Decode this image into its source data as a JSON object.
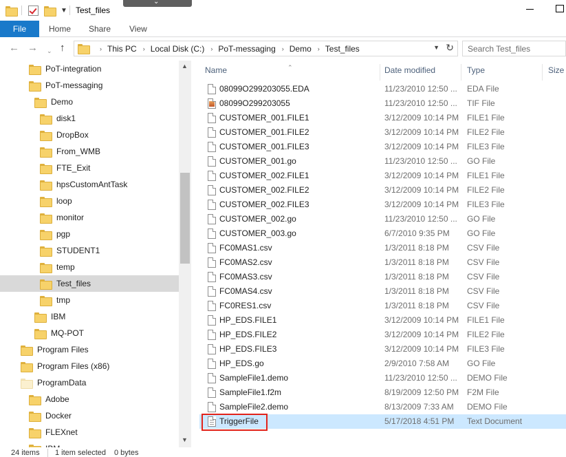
{
  "window": {
    "title": "Test_files"
  },
  "ribbon": {
    "file_tab": "File",
    "tabs": [
      "Home",
      "Share",
      "View"
    ]
  },
  "address": {
    "crumbs": [
      "This PC",
      "Local Disk (C:)",
      "PoT-messaging",
      "Demo",
      "Test_files"
    ],
    "search_placeholder": "Search Test_files"
  },
  "navigation": {
    "items": [
      {
        "label": "PoT-integration",
        "level": 1,
        "selected": false
      },
      {
        "label": "PoT-messaging",
        "level": 1,
        "selected": false
      },
      {
        "label": "Demo",
        "level": 2,
        "selected": false
      },
      {
        "label": "disk1",
        "level": 3,
        "selected": false
      },
      {
        "label": "DropBox",
        "level": 3,
        "selected": false
      },
      {
        "label": "From_WMB",
        "level": 3,
        "selected": false
      },
      {
        "label": "FTE_Exit",
        "level": 3,
        "selected": false
      },
      {
        "label": "hpsCustomAntTask",
        "level": 3,
        "selected": false
      },
      {
        "label": "loop",
        "level": 3,
        "selected": false
      },
      {
        "label": "monitor",
        "level": 3,
        "selected": false
      },
      {
        "label": "pgp",
        "level": 3,
        "selected": false
      },
      {
        "label": "STUDENT1",
        "level": 3,
        "selected": false
      },
      {
        "label": "temp",
        "level": 3,
        "selected": false
      },
      {
        "label": "Test_files",
        "level": 3,
        "selected": true
      },
      {
        "label": "tmp",
        "level": 3,
        "selected": false
      },
      {
        "label": "IBM",
        "level": 2,
        "selected": false
      },
      {
        "label": "MQ-POT",
        "level": 2,
        "selected": false
      },
      {
        "label": "Program Files",
        "level": 0,
        "selected": false
      },
      {
        "label": "Program Files (x86)",
        "level": 0,
        "selected": false
      },
      {
        "label": "ProgramData",
        "level": 0,
        "selected": false,
        "pale": true
      },
      {
        "label": "Adobe",
        "level": 1,
        "selected": false
      },
      {
        "label": "Docker",
        "level": 1,
        "selected": false
      },
      {
        "label": "FLEXnet",
        "level": 1,
        "selected": false
      },
      {
        "label": "IBM",
        "level": 1,
        "selected": false
      }
    ]
  },
  "columns": {
    "name": "Name",
    "date": "Date modified",
    "type": "Type",
    "size": "Size"
  },
  "files": [
    {
      "name": "08099O299203055.EDA",
      "date": "11/23/2010 12:50 ...",
      "type": "EDA File",
      "icon": "file-icon"
    },
    {
      "name": "08099O299203055",
      "date": "11/23/2010 12:50 ...",
      "type": "TIF File",
      "icon": "image-file-icon"
    },
    {
      "name": "CUSTOMER_001.FILE1",
      "date": "3/12/2009 10:14 PM",
      "type": "FILE1 File",
      "icon": "file-icon"
    },
    {
      "name": "CUSTOMER_001.FILE2",
      "date": "3/12/2009 10:14 PM",
      "type": "FILE2 File",
      "icon": "file-icon"
    },
    {
      "name": "CUSTOMER_001.FILE3",
      "date": "3/12/2009 10:14 PM",
      "type": "FILE3 File",
      "icon": "file-icon"
    },
    {
      "name": "CUSTOMER_001.go",
      "date": "11/23/2010 12:50 ...",
      "type": "GO File",
      "icon": "file-icon"
    },
    {
      "name": "CUSTOMER_002.FILE1",
      "date": "3/12/2009 10:14 PM",
      "type": "FILE1 File",
      "icon": "file-icon"
    },
    {
      "name": "CUSTOMER_002.FILE2",
      "date": "3/12/2009 10:14 PM",
      "type": "FILE2 File",
      "icon": "file-icon"
    },
    {
      "name": "CUSTOMER_002.FILE3",
      "date": "3/12/2009 10:14 PM",
      "type": "FILE3 File",
      "icon": "file-icon"
    },
    {
      "name": "CUSTOMER_002.go",
      "date": "11/23/2010 12:50 ...",
      "type": "GO File",
      "icon": "file-icon"
    },
    {
      "name": "CUSTOMER_003.go",
      "date": "6/7/2010 9:35 PM",
      "type": "GO File",
      "icon": "file-icon"
    },
    {
      "name": "FC0MAS1.csv",
      "date": "1/3/2011 8:18 PM",
      "type": "CSV File",
      "icon": "file-icon"
    },
    {
      "name": "FC0MAS2.csv",
      "date": "1/3/2011 8:18 PM",
      "type": "CSV File",
      "icon": "file-icon"
    },
    {
      "name": "FC0MAS3.csv",
      "date": "1/3/2011 8:18 PM",
      "type": "CSV File",
      "icon": "file-icon"
    },
    {
      "name": "FC0MAS4.csv",
      "date": "1/3/2011 8:18 PM",
      "type": "CSV File",
      "icon": "file-icon"
    },
    {
      "name": "FC0RES1.csv",
      "date": "1/3/2011 8:18 PM",
      "type": "CSV File",
      "icon": "file-icon"
    },
    {
      "name": "HP_EDS.FILE1",
      "date": "3/12/2009 10:14 PM",
      "type": "FILE1 File",
      "icon": "file-icon"
    },
    {
      "name": "HP_EDS.FILE2",
      "date": "3/12/2009 10:14 PM",
      "type": "FILE2 File",
      "icon": "file-icon"
    },
    {
      "name": "HP_EDS.FILE3",
      "date": "3/12/2009 10:14 PM",
      "type": "FILE3 File",
      "icon": "file-icon"
    },
    {
      "name": "HP_EDS.go",
      "date": "2/9/2010 7:58 AM",
      "type": "GO File",
      "icon": "file-icon"
    },
    {
      "name": "SampleFile1.demo",
      "date": "11/23/2010 12:50 ...",
      "type": "DEMO File",
      "icon": "file-icon"
    },
    {
      "name": "SampleFile1.f2m",
      "date": "8/19/2009 12:50 PM",
      "type": "F2M File",
      "icon": "file-icon"
    },
    {
      "name": "SampleFile2.demo",
      "date": "8/13/2009 7:33 AM",
      "type": "DEMO File",
      "icon": "file-icon"
    },
    {
      "name": "TriggerFile",
      "date": "5/17/2018 4:51 PM",
      "type": "Text Document",
      "icon": "text-document-icon",
      "selected": true,
      "highlighted": true
    }
  ],
  "status": {
    "item_count": "24 items",
    "selection": "1 item selected",
    "size": "0 bytes"
  },
  "colors": {
    "file_tab": "#1979ca",
    "selected_row": "#cce8ff",
    "highlight_box": "#e2231a",
    "nav_selected": "#d9d9d9"
  }
}
